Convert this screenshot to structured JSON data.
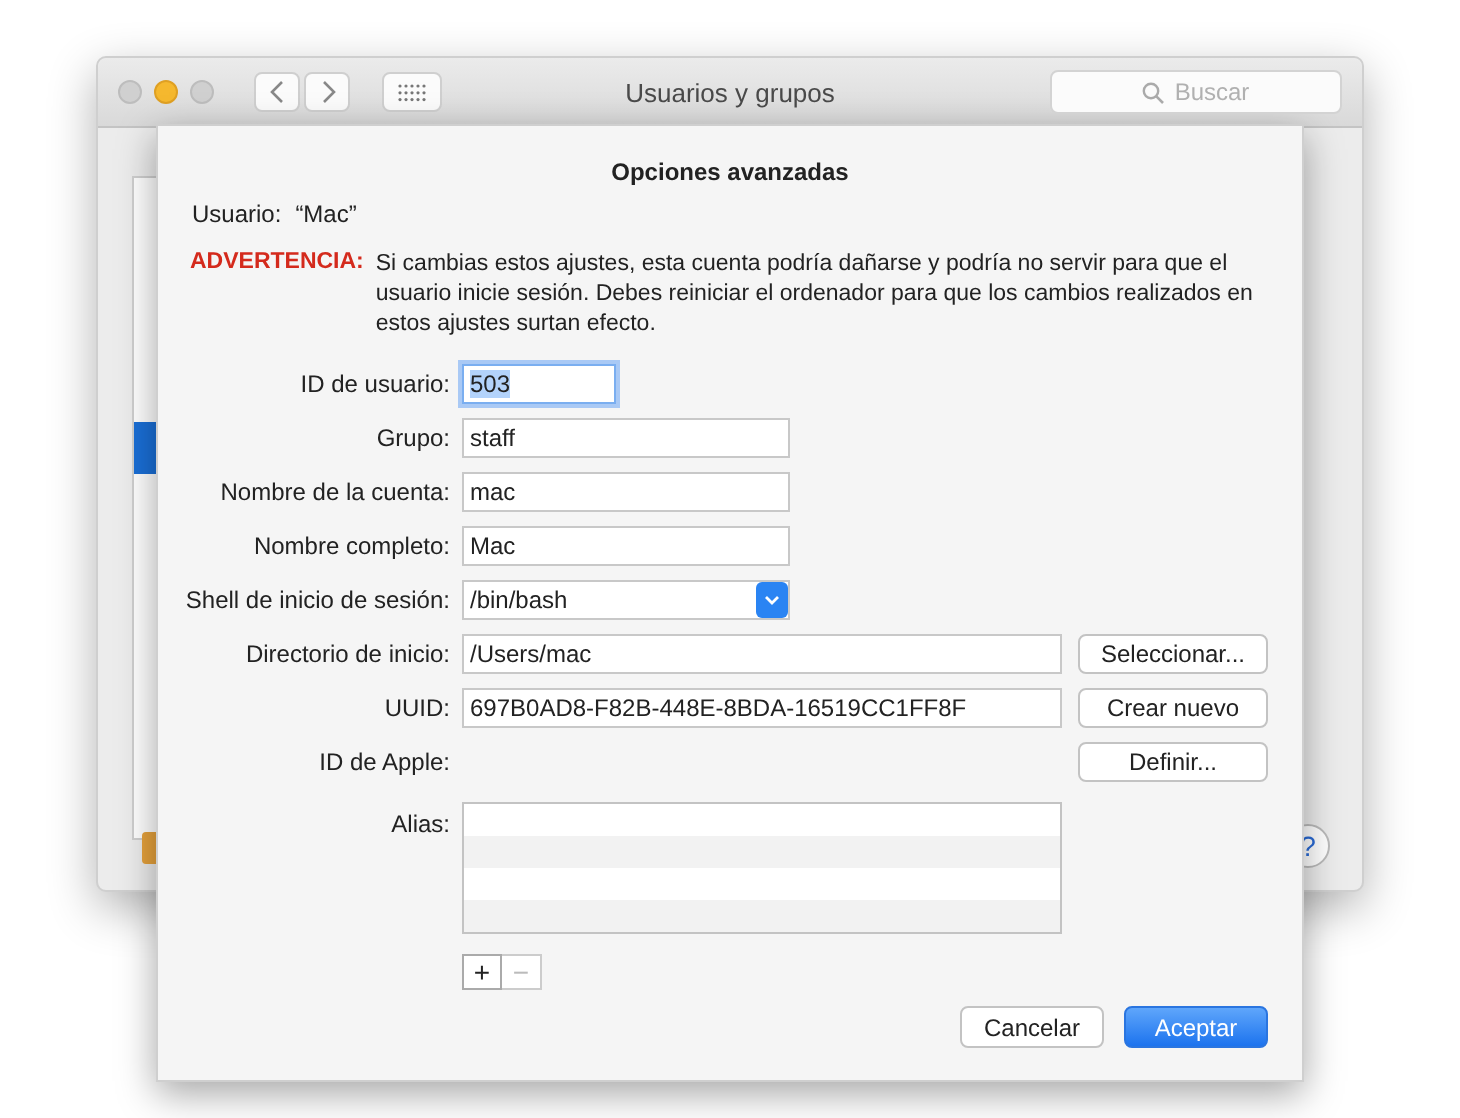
{
  "window": {
    "title": "Usuarios y grupos",
    "search": {
      "placeholder": "Buscar"
    },
    "help_button": "?"
  },
  "sheet": {
    "title": "Opciones avanzadas",
    "user_label": "Usuario:",
    "user_value": "“Mac”",
    "warning_label": "ADVERTENCIA:",
    "warning_text": "Si cambias estos ajustes, esta cuenta podría dañarse y podría no servir para que el usuario inicie sesión. Debes reiniciar el ordenador para que los cambios realizados en estos ajustes surtan efecto.",
    "fields": [
      {
        "kind": "number",
        "label": "ID de usuario:",
        "value": "503",
        "focused": true
      },
      {
        "kind": "text",
        "label": "Grupo:",
        "value": "staff",
        "focused": false
      },
      {
        "kind": "text",
        "label": "Nombre de la cuenta:",
        "value": "mac",
        "focused": false
      },
      {
        "kind": "text",
        "label": "Nombre completo:",
        "value": "Mac",
        "focused": false
      },
      {
        "kind": "popup",
        "label": "Shell de inicio de sesión:",
        "value": "/bin/bash",
        "focused": false
      },
      {
        "kind": "path",
        "label": "Directorio de inicio:",
        "value": "/Users/mac",
        "focused": false,
        "button": "Seleccionar..."
      },
      {
        "kind": "path",
        "label": "UUID:",
        "value": "697B0AD8-F82B-448E-8BDA-16519CC1FF8F",
        "focused": false,
        "button": "Crear nuevo"
      },
      {
        "kind": "action",
        "label": "ID de Apple:",
        "button": "Definir..."
      }
    ],
    "alias": {
      "label": "Alias:",
      "add_button": "+",
      "remove_button": "−",
      "remove_disabled": true
    },
    "buttons": [
      {
        "label": "Cancelar",
        "default": false
      },
      {
        "label": "Aceptar",
        "default": true
      }
    ]
  }
}
